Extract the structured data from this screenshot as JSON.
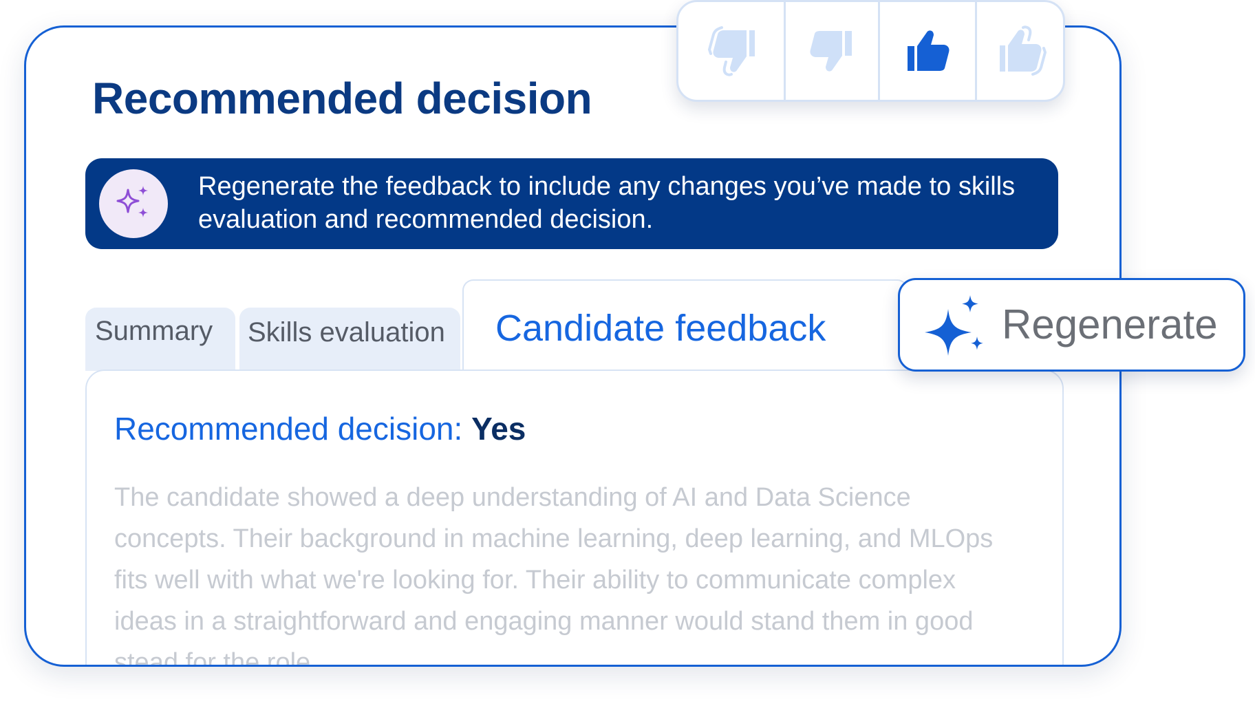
{
  "page": {
    "title": "Recommended decision"
  },
  "banner": {
    "icon": "sparkles-icon",
    "text": "Regenerate the feedback to include any changes you’ve made to skills evaluation and recommended decision."
  },
  "tabs": [
    {
      "label": "Summary",
      "active": false
    },
    {
      "label": "Skills evaluation",
      "active": false
    },
    {
      "label": "Candidate feedback",
      "active": true
    }
  ],
  "content": {
    "decision_label": "Recommended decision:",
    "decision_value": "Yes",
    "feedback_text": "The candidate showed a deep understanding of AI and Data Science concepts. Their background in machine learning, deep learning, and MLOps fits well with what we're looking for. Their ability to communicate complex ideas in a straightforward and engaging manner would stand them in good stead for the role."
  },
  "feedback_rating": {
    "options": [
      {
        "icon": "double-thumbs-down-icon",
        "selected": false
      },
      {
        "icon": "thumbs-down-icon",
        "selected": false
      },
      {
        "icon": "thumbs-up-icon",
        "selected": true
      },
      {
        "icon": "double-thumbs-up-icon",
        "selected": false
      }
    ]
  },
  "regenerate": {
    "label": "Regenerate",
    "icon": "sparkles-icon"
  },
  "colors": {
    "primary": "#1560d4",
    "dark_navy": "#033987",
    "title": "#0b3a82",
    "active_tab_text": "#1666e0",
    "inactive_tab_bg": "#e7eef9",
    "muted_text": "#c6cad1",
    "icon_light": "#cfe0f8",
    "icon_selected": "#1560d4",
    "banner_icon_bg": "#f1e9f8",
    "banner_icon_fg": "#8e4ed6"
  }
}
